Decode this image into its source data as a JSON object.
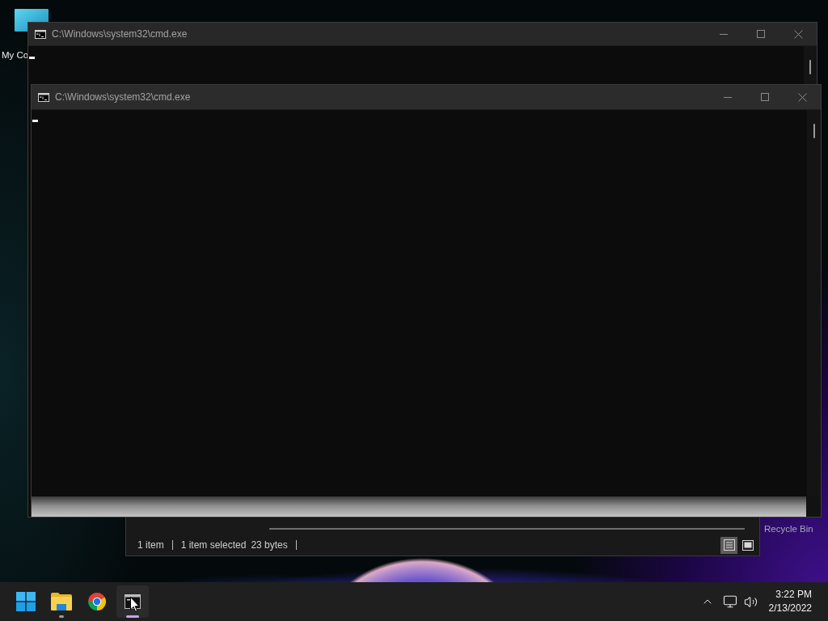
{
  "desktop_icons": [
    {
      "label": "My Co",
      "kind": "monitor"
    },
    {
      "label": "Recycle Bin",
      "kind": "covered"
    }
  ],
  "explorer_window": {
    "status_bar": {
      "groups": [
        [
          "1 item"
        ],
        [
          "1 item selected",
          "23 bytes"
        ]
      ]
    },
    "view_buttons": [
      {
        "kind": "details",
        "selected": true
      },
      {
        "kind": "large_icons",
        "selected": false
      }
    ]
  },
  "windows": [
    {
      "title": "C:\\Windows\\system32\\cmd.exe"
    },
    {
      "title": "C:\\Windows\\system32\\cmd.exe"
    }
  ],
  "taskbar": {
    "apps": [
      {
        "kind": "start",
        "running": false,
        "selected": false
      },
      {
        "kind": "folder",
        "running": true,
        "selected": false
      },
      {
        "kind": "browser",
        "running": false,
        "selected": false
      },
      {
        "kind": "terminal",
        "running": true,
        "selected": true
      }
    ],
    "tray": {
      "time": "3:22 PM",
      "date": "2/13/2022"
    }
  }
}
